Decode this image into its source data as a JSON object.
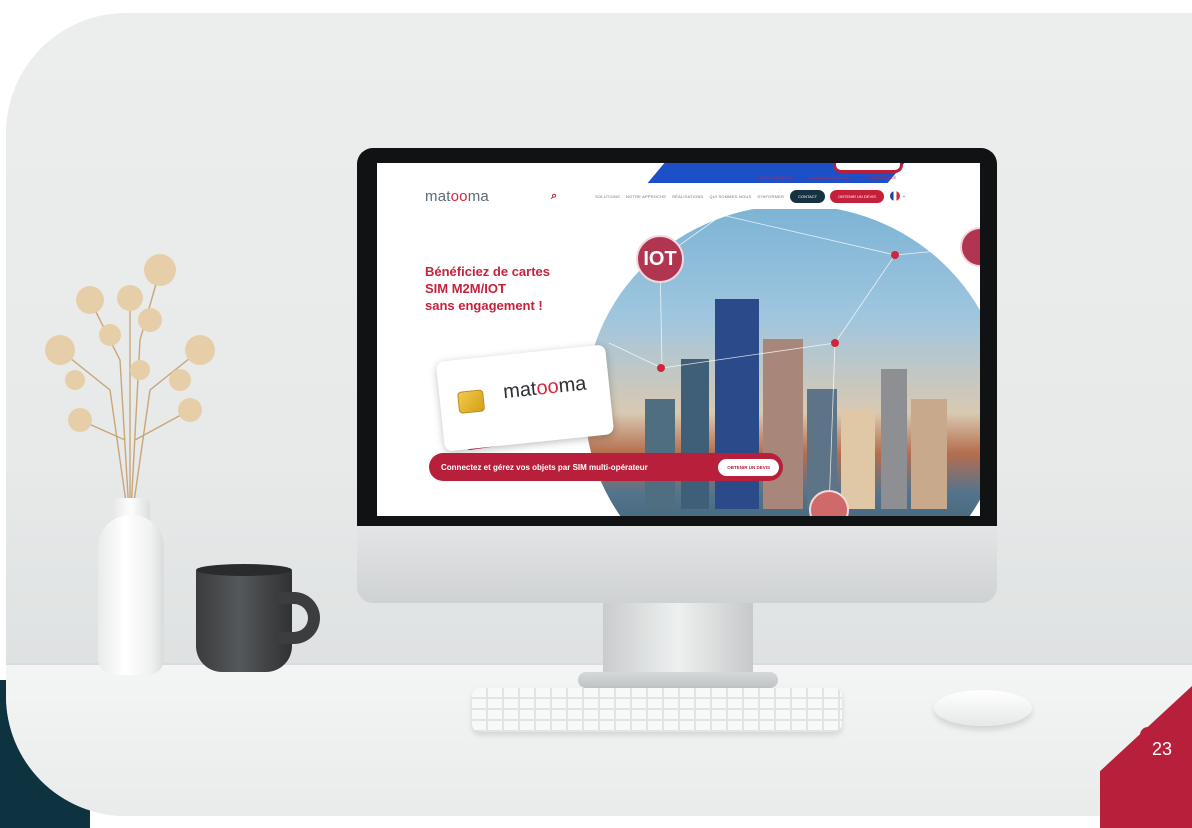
{
  "website": {
    "topbar": {
      "phone": "+33 (0)4 84 56 07 42",
      "email": "contact@matooma.com",
      "account": "MON ESPACE"
    },
    "logo": {
      "prefix": "mat",
      "oo": "oo",
      "suffix": "ma"
    },
    "menu": [
      "SOLUTIONS",
      "NOTRE APPROCHE",
      "RÉALISATIONS",
      "QUI SOMMES-NOUS",
      "S'INFORMER"
    ],
    "contact_label": "CONTACT",
    "quote_label": "OBTENIR UN DEVIS",
    "hero_title": "Bénéficiez de cartes\nSIM M2M/IOT\nsans engagement !",
    "iot_badge": "IOT",
    "sim_logo": {
      "prefix": "mat",
      "oo": "oo",
      "suffix": "ma"
    },
    "cta_text": "Connectez et gérez vos objets par SIM multi-opérateur",
    "cta_button": "OBTENIR UN DEVIS"
  },
  "page_number": "23",
  "colors": {
    "brand_red": "#b81f3a",
    "dark_teal": "#0d3341",
    "navy_button": "#143241"
  },
  "icons": [
    "search-icon",
    "user-icon",
    "flag-fr-icon",
    "chevron-down-icon"
  ]
}
